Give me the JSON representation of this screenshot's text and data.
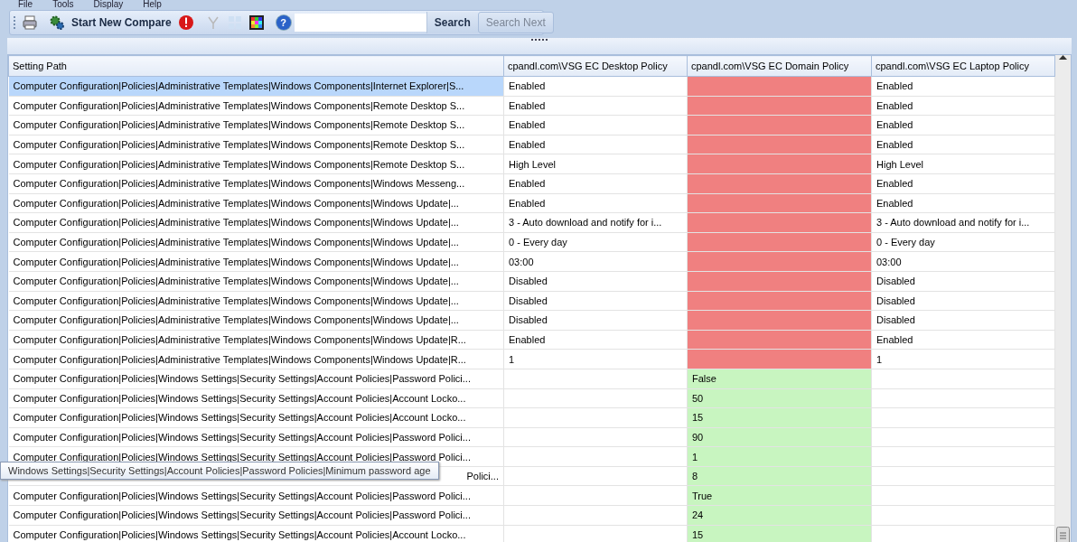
{
  "menu": [
    {
      "label": "File"
    },
    {
      "label": "Tools"
    },
    {
      "label": "Display"
    },
    {
      "label": "Help"
    }
  ],
  "toolbar": {
    "compare_button": "Start New Compare",
    "help_icon": "?",
    "search_button": {
      "label": "Search",
      "disabled": false
    },
    "search_next_button": {
      "label": "Search Next",
      "disabled": true
    }
  },
  "table": {
    "columns": [
      "Setting Path",
      "cpandl.com\\VSG EC Desktop Policy",
      "cpandl.com\\VSG EC Domain Policy",
      "cpandl.com\\VSG EC Laptop Policy"
    ],
    "rows": [
      {
        "path": "Computer Configuration|Policies|Administrative Templates|Windows Components|Internet Explorer|S...",
        "desktop": "Enabled",
        "domain": "",
        "laptop": "Enabled",
        "color": "#f08080",
        "selected": true,
        "covered": false
      },
      {
        "path": "Computer Configuration|Policies|Administrative Templates|Windows Components|Remote Desktop S...",
        "desktop": "Enabled",
        "domain": "",
        "laptop": "Enabled",
        "color": "#f08080",
        "selected": false,
        "covered": false
      },
      {
        "path": "Computer Configuration|Policies|Administrative Templates|Windows Components|Remote Desktop S...",
        "desktop": "Enabled",
        "domain": "",
        "laptop": "Enabled",
        "color": "#f08080",
        "selected": false,
        "covered": false
      },
      {
        "path": "Computer Configuration|Policies|Administrative Templates|Windows Components|Remote Desktop S...",
        "desktop": "Enabled",
        "domain": "",
        "laptop": "Enabled",
        "color": "#f08080",
        "selected": false,
        "covered": false
      },
      {
        "path": "Computer Configuration|Policies|Administrative Templates|Windows Components|Remote Desktop S...",
        "desktop": "High Level",
        "domain": "",
        "laptop": "High Level",
        "color": "#f08080",
        "selected": false,
        "covered": false
      },
      {
        "path": "Computer Configuration|Policies|Administrative Templates|Windows Components|Windows Messeng...",
        "desktop": "Enabled",
        "domain": "",
        "laptop": "Enabled",
        "color": "#f08080",
        "selected": false,
        "covered": false
      },
      {
        "path": "Computer Configuration|Policies|Administrative Templates|Windows Components|Windows Update|...",
        "desktop": "Enabled",
        "domain": "",
        "laptop": "Enabled",
        "color": "#f08080",
        "selected": false,
        "covered": false
      },
      {
        "path": "Computer Configuration|Policies|Administrative Templates|Windows Components|Windows Update|...",
        "desktop": "3 - Auto download and notify for i...",
        "domain": "",
        "laptop": "3 - Auto download and notify for i...",
        "color": "#f08080",
        "selected": false,
        "covered": false
      },
      {
        "path": "Computer Configuration|Policies|Administrative Templates|Windows Components|Windows Update|...",
        "desktop": "0 - Every day",
        "domain": "",
        "laptop": "0 - Every day",
        "color": "#f08080",
        "selected": false,
        "covered": false
      },
      {
        "path": "Computer Configuration|Policies|Administrative Templates|Windows Components|Windows Update|...",
        "desktop": "03:00",
        "domain": "",
        "laptop": "03:00",
        "color": "#f08080",
        "selected": false,
        "covered": false
      },
      {
        "path": "Computer Configuration|Policies|Administrative Templates|Windows Components|Windows Update|...",
        "desktop": "Disabled",
        "domain": "",
        "laptop": "Disabled",
        "color": "#f08080",
        "selected": false,
        "covered": false
      },
      {
        "path": "Computer Configuration|Policies|Administrative Templates|Windows Components|Windows Update|...",
        "desktop": "Disabled",
        "domain": "",
        "laptop": "Disabled",
        "color": "#f08080",
        "selected": false,
        "covered": false
      },
      {
        "path": "Computer Configuration|Policies|Administrative Templates|Windows Components|Windows Update|...",
        "desktop": "Disabled",
        "domain": "",
        "laptop": "Disabled",
        "color": "#f08080",
        "selected": false,
        "covered": false
      },
      {
        "path": "Computer Configuration|Policies|Administrative Templates|Windows Components|Windows Update|R...",
        "desktop": "Enabled",
        "domain": "",
        "laptop": "Enabled",
        "color": "#f08080",
        "selected": false,
        "covered": false
      },
      {
        "path": "Computer Configuration|Policies|Administrative Templates|Windows Components|Windows Update|R...",
        "desktop": "1",
        "domain": "",
        "laptop": "1",
        "color": "#f08080",
        "selected": false,
        "covered": false
      },
      {
        "path": "Computer Configuration|Policies|Windows Settings|Security Settings|Account Policies|Password Polici...",
        "desktop": "",
        "domain": "False",
        "laptop": "",
        "color": "#c8f5c0",
        "selected": false,
        "covered": false
      },
      {
        "path": "Computer Configuration|Policies|Windows Settings|Security Settings|Account Policies|Account Locko...",
        "desktop": "",
        "domain": "50",
        "laptop": "",
        "color": "#c8f5c0",
        "selected": false,
        "covered": false
      },
      {
        "path": "Computer Configuration|Policies|Windows Settings|Security Settings|Account Policies|Account Locko...",
        "desktop": "",
        "domain": "15",
        "laptop": "",
        "color": "#c8f5c0",
        "selected": false,
        "covered": false
      },
      {
        "path": "Computer Configuration|Policies|Windows Settings|Security Settings|Account Policies|Password Polici...",
        "desktop": "",
        "domain": "90",
        "laptop": "",
        "color": "#c8f5c0",
        "selected": false,
        "covered": false
      },
      {
        "path": "Computer Configuration|Policies|Windows Settings|Security Settings|Account Policies|Password Polici...",
        "desktop": "",
        "domain": "1",
        "laptop": "",
        "color": "#c8f5c0",
        "selected": false,
        "covered": false
      },
      {
        "path": "Polici...",
        "desktop": "",
        "domain": "8",
        "laptop": "",
        "color": "#c8f5c0",
        "selected": false,
        "covered": true
      },
      {
        "path": "Computer Configuration|Policies|Windows Settings|Security Settings|Account Policies|Password Polici...",
        "desktop": "",
        "domain": "True",
        "laptop": "",
        "color": "#c8f5c0",
        "selected": false,
        "covered": false
      },
      {
        "path": "Computer Configuration|Policies|Windows Settings|Security Settings|Account Policies|Password Polici...",
        "desktop": "",
        "domain": "24",
        "laptop": "",
        "color": "#c8f5c0",
        "selected": false,
        "covered": false
      },
      {
        "path": "Computer Configuration|Policies|Windows Settings|Security Settings|Account Policies|Account Locko...",
        "desktop": "",
        "domain": "15",
        "laptop": "",
        "color": "#c8f5c0",
        "selected": false,
        "covered": false
      }
    ]
  },
  "tooltip": "Windows Settings|Security Settings|Account Policies|Password Policies|Minimum password age"
}
